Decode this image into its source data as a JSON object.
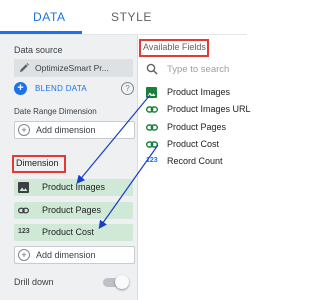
{
  "tabs": [
    {
      "label": "DATA",
      "active": true
    },
    {
      "label": "STYLE",
      "active": false
    }
  ],
  "left_panel": {
    "data_source_label": "Data source",
    "data_source_name": "OptimizeSmart Pr...",
    "blend_label": "BLEND DATA",
    "help_glyph": "?",
    "date_range_label": "Date Range Dimension",
    "add_dimension_label": "Add dimension",
    "dimension_label": "Dimension",
    "dimensions": [
      {
        "label": "Product Images",
        "icon": "image-icon"
      },
      {
        "label": "Product Pages",
        "icon": "link-icon"
      },
      {
        "label": "Product Cost",
        "icon": "number-type-icon",
        "type_text": "123"
      }
    ],
    "add_dimension_label_2": "Add dimension",
    "drill_down_label": "Drill down",
    "drill_down_on": false
  },
  "right_panel": {
    "available_fields_label": "Available Fields",
    "search_placeholder": "Type to search",
    "fields": [
      {
        "label": "Product Images",
        "icon": "image-icon"
      },
      {
        "label": "Product Images URL",
        "icon": "link-icon"
      },
      {
        "label": "Product Pages",
        "icon": "link-icon"
      },
      {
        "label": "Product Cost",
        "icon": "link-icon"
      },
      {
        "label": "Record Count",
        "icon": "number-type-icon",
        "type_text": "123"
      }
    ]
  },
  "colors": {
    "accent": "#1a73e8",
    "highlight_box": "#e53935",
    "dimension_chip": "#cfe9d6",
    "field_icon": "#188038",
    "arrow": "#1a3fc7"
  }
}
